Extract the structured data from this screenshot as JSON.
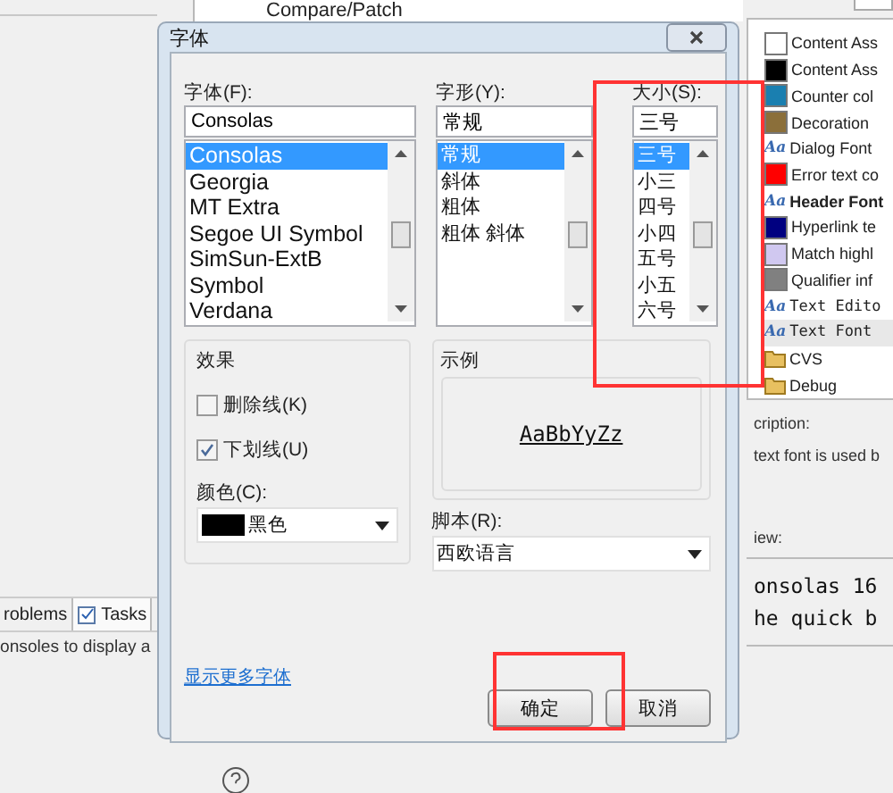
{
  "background": {
    "tree_item": "Compare/Patch",
    "bottom_tabs": [
      {
        "label": "roblems",
        "selected": false
      },
      {
        "label": "Tasks",
        "selected": true
      }
    ],
    "console_text": "onsoles to display a",
    "right_list": [
      {
        "kind": "color",
        "label": "Content Ass",
        "color": "#ffffff",
        "selected": false
      },
      {
        "kind": "color",
        "label": "Content Ass",
        "color": "#000000",
        "selected": false
      },
      {
        "kind": "color",
        "label": "Counter col",
        "color": "#1a7fb0",
        "selected": false
      },
      {
        "kind": "color",
        "label": "Decoration",
        "color": "#8b6f3a",
        "selected": false
      },
      {
        "kind": "font",
        "icon": "Aa",
        "label": "Dialog Font",
        "bold": false,
        "mono": false,
        "selected": false
      },
      {
        "kind": "color",
        "label": "Error text co",
        "color": "#ff0000",
        "selected": false
      },
      {
        "kind": "font",
        "icon": "Aa",
        "label": "Header Font",
        "bold": true,
        "mono": false,
        "selected": false
      },
      {
        "kind": "color",
        "label": "Hyperlink te",
        "color": "#000080",
        "selected": false
      },
      {
        "kind": "color",
        "label": "Match highl",
        "color": "#d0c8f0",
        "selected": false
      },
      {
        "kind": "color",
        "label": "Qualifier inf",
        "color": "#808080",
        "selected": false
      },
      {
        "kind": "font",
        "icon": "Aa",
        "label": "Text Edito",
        "bold": false,
        "mono": true,
        "selected": false
      },
      {
        "kind": "font",
        "icon": "Aa",
        "label": "Text Font",
        "bold": false,
        "mono": true,
        "selected": true
      },
      {
        "kind": "folder",
        "label": "CVS",
        "selected": false
      },
      {
        "kind": "folder",
        "label": "Debug",
        "selected": false
      }
    ],
    "description_label": "cription:",
    "description_text": "text font is used b",
    "preview_label": "iew:",
    "preview_lines": [
      "onsolas 16",
      "he quick b"
    ]
  },
  "dialog": {
    "title": "字体",
    "font": {
      "label": "字体(F):",
      "value": "Consolas",
      "items": [
        {
          "label": "Consolas",
          "selected": true
        },
        {
          "label": "Georgia",
          "selected": false
        },
        {
          "label": "MT Extra",
          "selected": false
        },
        {
          "label": "Segoe UI Symbol",
          "selected": false
        },
        {
          "label": "SimSun-ExtB",
          "selected": false
        },
        {
          "label": "Symbol",
          "selected": false
        },
        {
          "label": "Verdana",
          "selected": false
        }
      ]
    },
    "style": {
      "label": "字形(Y):",
      "value": "常规",
      "items": [
        {
          "label": "常规",
          "selected": true
        },
        {
          "label": "斜体",
          "selected": false
        },
        {
          "label": "粗体",
          "selected": false
        },
        {
          "label": "粗体 斜体",
          "selected": false
        }
      ]
    },
    "size": {
      "label": "大小(S):",
      "value": "三号",
      "items": [
        {
          "label": "三号",
          "selected": true
        },
        {
          "label": "小三",
          "selected": false
        },
        {
          "label": "四号",
          "selected": false
        },
        {
          "label": "小四",
          "selected": false
        },
        {
          "label": "五号",
          "selected": false
        },
        {
          "label": "小五",
          "selected": false
        },
        {
          "label": "六号",
          "selected": false
        }
      ]
    },
    "effects": {
      "title": "效果",
      "checkboxes": [
        {
          "label": "删除线(K)",
          "checked": false
        },
        {
          "label": "下划线(U)",
          "checked": true
        }
      ],
      "color_label": "颜色(C):",
      "color_value": "黑色",
      "color": "#000000"
    },
    "sample": {
      "title": "示例",
      "text": "AaBbYyZz"
    },
    "script": {
      "label": "脚本(R):",
      "value": "西欧语言"
    },
    "more_link": "显示更多字体",
    "buttons": [
      "确定",
      "取消"
    ]
  }
}
